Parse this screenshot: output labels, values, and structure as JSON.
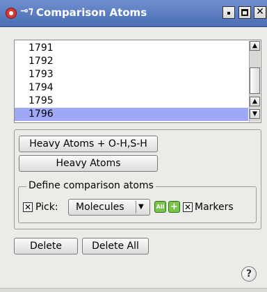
{
  "window": {
    "title": "Comparison Atoms"
  },
  "list": {
    "items": [
      "1791",
      "1792",
      "1793",
      "1794",
      "1795",
      "1796"
    ],
    "selected_index": 5
  },
  "buttons": {
    "heavy_oh_sh": "Heavy Atoms + O-H,S-H",
    "heavy": "Heavy Atoms",
    "delete": "Delete",
    "delete_all": "Delete All"
  },
  "define_group": {
    "legend": "Define comparison atoms",
    "pick_label": "Pick:",
    "pick_checked": true,
    "mode": "Molecules",
    "all_icon_label": "All",
    "markers_label": "Markers",
    "markers_checked": true
  },
  "icons": {
    "app": "app-icon",
    "pin": "pin-icon",
    "help": "help-icon",
    "accent_green": "#7ac24a",
    "selection": "#9ea8f5",
    "titlebar": "#4a6db4"
  }
}
